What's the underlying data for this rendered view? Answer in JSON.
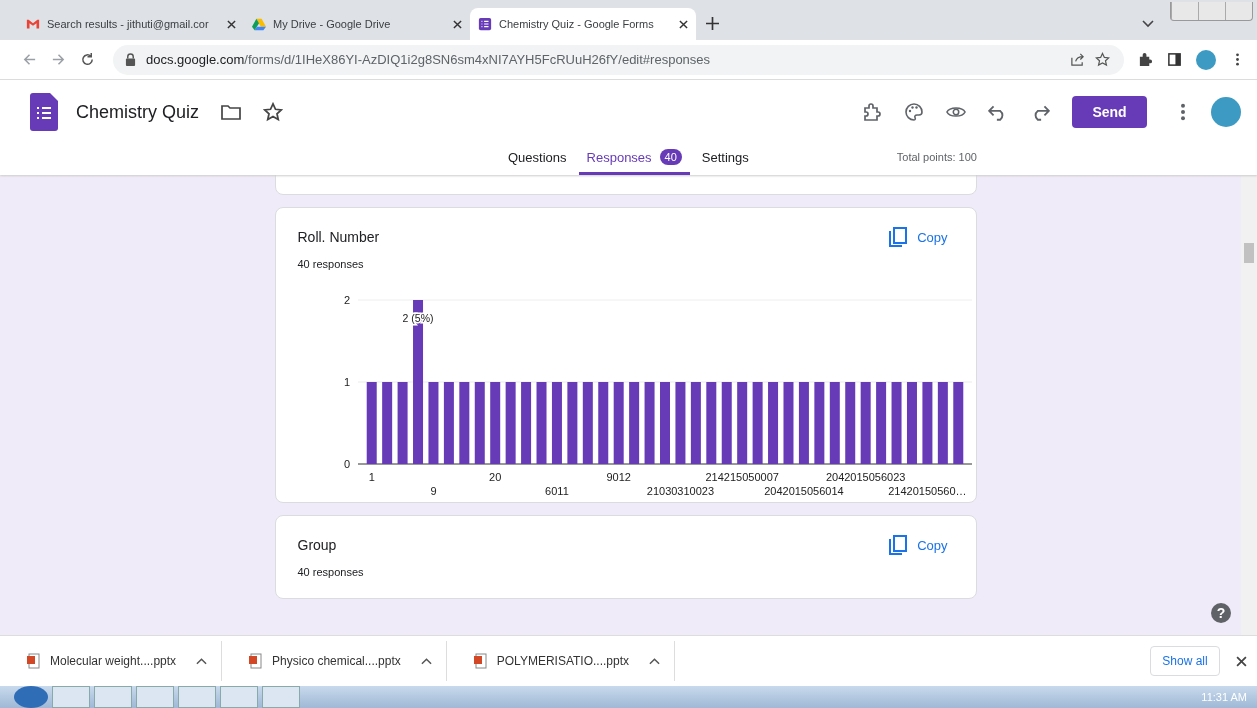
{
  "browser": {
    "tabs": [
      {
        "kind": "mail",
        "title": "Search results - jithuti@gmail.cor",
        "selected": false
      },
      {
        "kind": "drive",
        "title": "My Drive - Google Drive",
        "selected": false
      },
      {
        "kind": "forms",
        "title": "Chemistry Quiz - Google Forms",
        "selected": true
      }
    ],
    "url_host": "docs.google.com",
    "url_path": "/forms/d/1IHeX86YI-AzDIQ1i2g8SN6sm4xNI7AYH5FcRUuH26fY/edit#responses"
  },
  "form": {
    "title": "Chemistry Quiz",
    "send": "Send",
    "tabs": [
      {
        "label": "Questions",
        "selected": false
      },
      {
        "label": "Responses",
        "selected": true,
        "badge": "40"
      },
      {
        "label": "Settings",
        "selected": false
      }
    ],
    "total_points": "Total points: 100"
  },
  "cards": [
    {
      "title": "Roll. Number",
      "subtitle": "40 responses",
      "copy": "Copy",
      "chart_data": {
        "type": "bar",
        "categories": [
          "1",
          null,
          null,
          null,
          "9",
          null,
          null,
          null,
          "20",
          null,
          null,
          null,
          "6011",
          null,
          null,
          null,
          "9012",
          null,
          null,
          null,
          "21030310023",
          null,
          null,
          null,
          "214215050007",
          null,
          null,
          null,
          "2042015056014",
          null,
          null,
          null,
          "2042015056023",
          null,
          null,
          null,
          "21420150560…",
          null,
          null
        ],
        "values": [
          1,
          1,
          1,
          2,
          1,
          1,
          1,
          1,
          1,
          1,
          1,
          1,
          1,
          1,
          1,
          1,
          1,
          1,
          1,
          1,
          1,
          1,
          1,
          1,
          1,
          1,
          1,
          1,
          1,
          1,
          1,
          1,
          1,
          1,
          1,
          1,
          1,
          1,
          1
        ],
        "ylim": [
          0,
          2
        ],
        "yticks": [
          0,
          1,
          2
        ],
        "value_labels": [
          null,
          null,
          null,
          "2 (5%)",
          null,
          null,
          null,
          null,
          null,
          null,
          null,
          null,
          null,
          null,
          null,
          null,
          null,
          null,
          null,
          null,
          null,
          null,
          null,
          null,
          null,
          null,
          null,
          null,
          null,
          null,
          null,
          null,
          null,
          null,
          null,
          null,
          null,
          null,
          null
        ]
      }
    },
    {
      "title": "Group",
      "subtitle": "40 responses",
      "copy": "Copy"
    }
  ],
  "downloads": {
    "items": [
      "Molecular weight....pptx",
      "Physico chemical....pptx",
      "POLYMERISATIO....pptx"
    ],
    "show_all": "Show all"
  },
  "taskbar": {
    "clock": "11:31 AM"
  },
  "help": "?"
}
